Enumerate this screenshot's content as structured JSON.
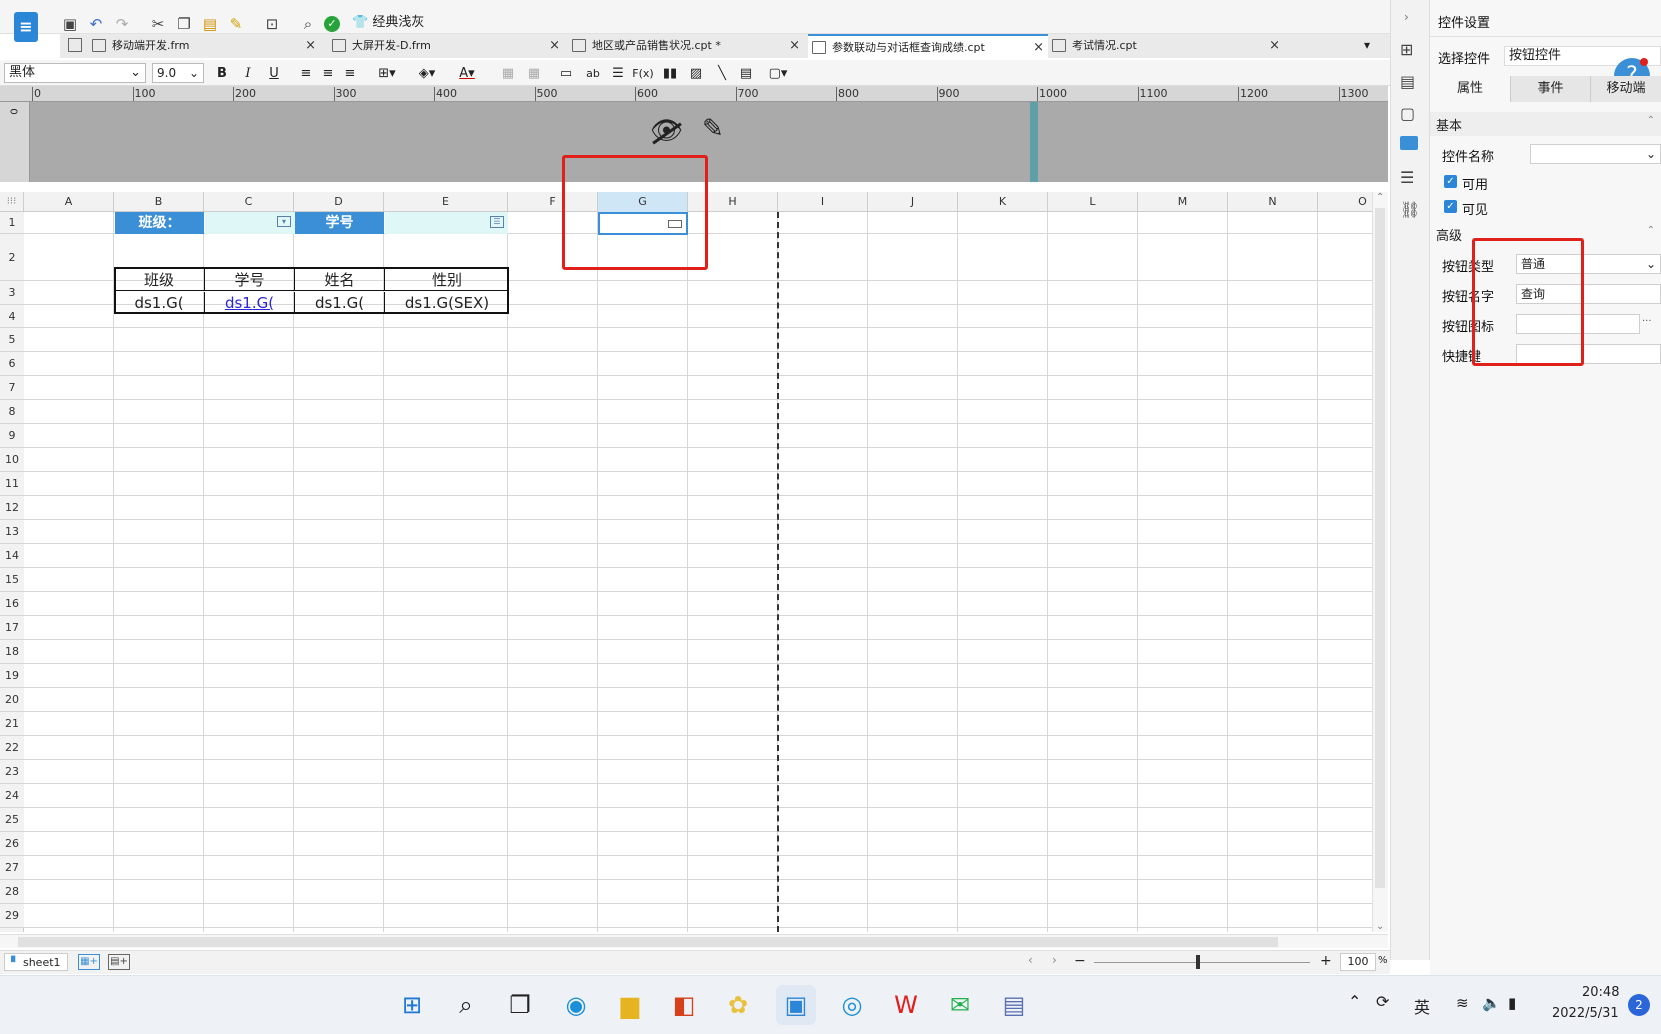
{
  "toolbar": {
    "theme_label": "经典浅灰"
  },
  "tabs": [
    {
      "label": "移动端开发.frm",
      "close": "×"
    },
    {
      "label": "大屏开发-D.frm",
      "close": "×"
    },
    {
      "label": "地区或产品销售状况.cpt *",
      "close": "×"
    },
    {
      "label": "参数联动与对话框查询成绩.cpt",
      "close": "×"
    },
    {
      "label": "考试情况.cpt",
      "close": "×"
    }
  ],
  "format": {
    "font": "黑体",
    "size": "9.0",
    "bold": "B",
    "italic": "I",
    "underline": "U",
    "text_btn": "ab",
    "formula_btn": "F(x)"
  },
  "ruler": {
    "ticks": [
      "0",
      "100",
      "200",
      "300",
      "400",
      "500",
      "600",
      "700",
      "800",
      "900",
      "1000",
      "1100",
      "1200",
      "1300"
    ],
    "v_tick": "0"
  },
  "grid": {
    "columns": [
      "A",
      "B",
      "C",
      "D",
      "E",
      "F",
      "G",
      "H",
      "I",
      "J",
      "K",
      "L",
      "M",
      "N",
      "O"
    ],
    "rows": [
      "1",
      "2",
      "3",
      "4",
      "5",
      "6",
      "7",
      "8",
      "9",
      "10",
      "11",
      "12",
      "13",
      "14",
      "15",
      "16",
      "17",
      "18",
      "19",
      "20",
      "21",
      "22",
      "23",
      "24",
      "25",
      "26",
      "27",
      "28",
      "29"
    ],
    "param_label_class": "班级：",
    "param_label_id": "学号",
    "headers": [
      "班级",
      "学号",
      "姓名",
      "性别"
    ],
    "data": [
      "ds1.G(",
      "ds1.G(",
      "ds1.G(",
      "ds1.G(SEX)"
    ]
  },
  "status": {
    "sheet": "sheet1",
    "zoom": "100",
    "zoom_unit": "%",
    "minus": "−",
    "plus": "+"
  },
  "right_panel": {
    "title": "控件设置",
    "select_label": "选择控件",
    "select_value": "按钮控件",
    "tabs": [
      "属性",
      "事件",
      "移动端"
    ],
    "section_basic": "基本",
    "name_label": "控件名称",
    "enabled": "可用",
    "visible": "可见",
    "section_adv": "高级",
    "btn_type_label": "按钮类型",
    "btn_type_value": "普通",
    "btn_name_label": "按钮名字",
    "btn_name_value": "查询",
    "btn_icon_label": "按钮图标",
    "shortcut_label": "快捷键",
    "ellipsis": "···",
    "help": "?"
  },
  "taskbar": {
    "ime": "英",
    "time": "20:48",
    "date": "2022/5/31",
    "badge": "2"
  },
  "colors": {
    "header_blue": "#3a8fd6",
    "param_cyan": "#dff7f7",
    "highlight_red": "#e0201b",
    "link_blue": "#2a28d4",
    "tab_active": "#ffffff"
  }
}
